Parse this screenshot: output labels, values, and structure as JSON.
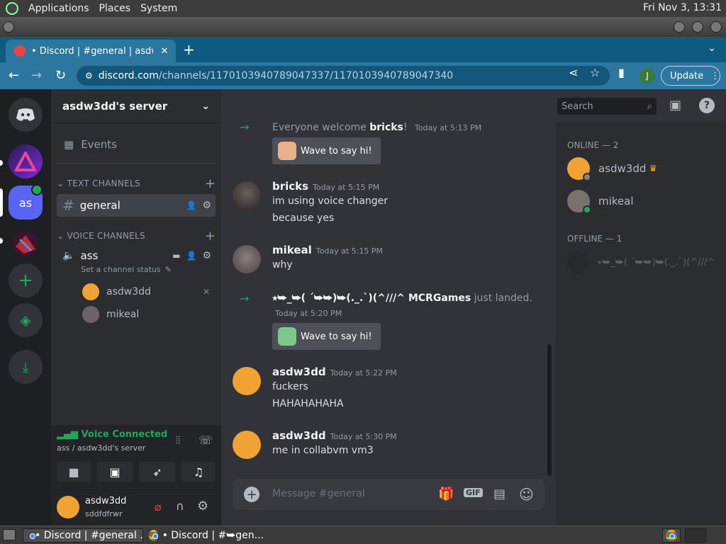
{
  "gnome": {
    "menus": [
      "Applications",
      "Places",
      "System"
    ],
    "clock": "Fri Nov  3, 13:31"
  },
  "chrome": {
    "tab_title": "• Discord | #general | asdw3dd",
    "url_host": "discord.com",
    "url_path": "/channels/1170103940789047337/1170103940789047340",
    "avatar_letter": "J",
    "update_label": "Update"
  },
  "servers": {
    "active_label": "as"
  },
  "sidebar": {
    "server_name": "asdw3dd's server",
    "events_label": "Events",
    "text_category": "TEXT CHANNELS",
    "text_channel": "general",
    "voice_category": "VOICE CHANNELS",
    "voice_channel": "ass",
    "voice_status_placeholder": "Set a channel status",
    "voice_members": [
      "asdw3dd",
      "mikeal"
    ]
  },
  "voice_panel": {
    "status": "Voice Connected",
    "location": "ass / asdw3dd's server"
  },
  "user": {
    "name": "asdw3dd",
    "status": "sddfdfrwr"
  },
  "chat": {
    "channel_name": "general",
    "search_placeholder": "Search",
    "join1_pre": "Everyone welcome",
    "join1_name": "bricks",
    "join1_post": "!",
    "join1_time": "Today at 5:13 PM",
    "wave_label": "Wave to say hi!",
    "m1_author": "bricks",
    "m1_time": "Today at 5:15 PM",
    "m1_lines": [
      "im using voice changer",
      "because yes"
    ],
    "m2_author": "mikeal",
    "m2_time": "Today at 5:15 PM",
    "m2_lines": [
      "why"
    ],
    "join2_name": "⭑⮩_⮩( ´⮩⮩)⮩(._.`)(^///^ MCRGames",
    "join2_post": "just landed.",
    "join2_time": "Today at 5:20 PM",
    "m3_author": "asdw3dd",
    "m3_time": "Today at 5:22 PM",
    "m3_lines": [
      "fuckers",
      "HAHAHAHAHA"
    ],
    "m4_author": "asdw3dd",
    "m4_time": "Today at 5:30 PM",
    "m4_lines": [
      "me in collabvm vm3"
    ],
    "composer_placeholder": "Message #general",
    "gif_label": "GIF"
  },
  "members": {
    "online_header": "ONLINE — 2",
    "online": [
      "asdw3dd",
      "mikeal"
    ],
    "offline_header": "OFFLINE — 1",
    "offline": [
      "⭑⮩_⮩( ´⮩⮩)⮩(._.`)(^///^..."
    ]
  },
  "taskbar": {
    "task1": "• Discord | #general ...",
    "task2": "• Discord | #⮩gen..."
  },
  "colors": {
    "blurple": "#5865f2",
    "green": "#23a55a",
    "red": "#ed4245",
    "orange_avatar": "#f0a232"
  }
}
